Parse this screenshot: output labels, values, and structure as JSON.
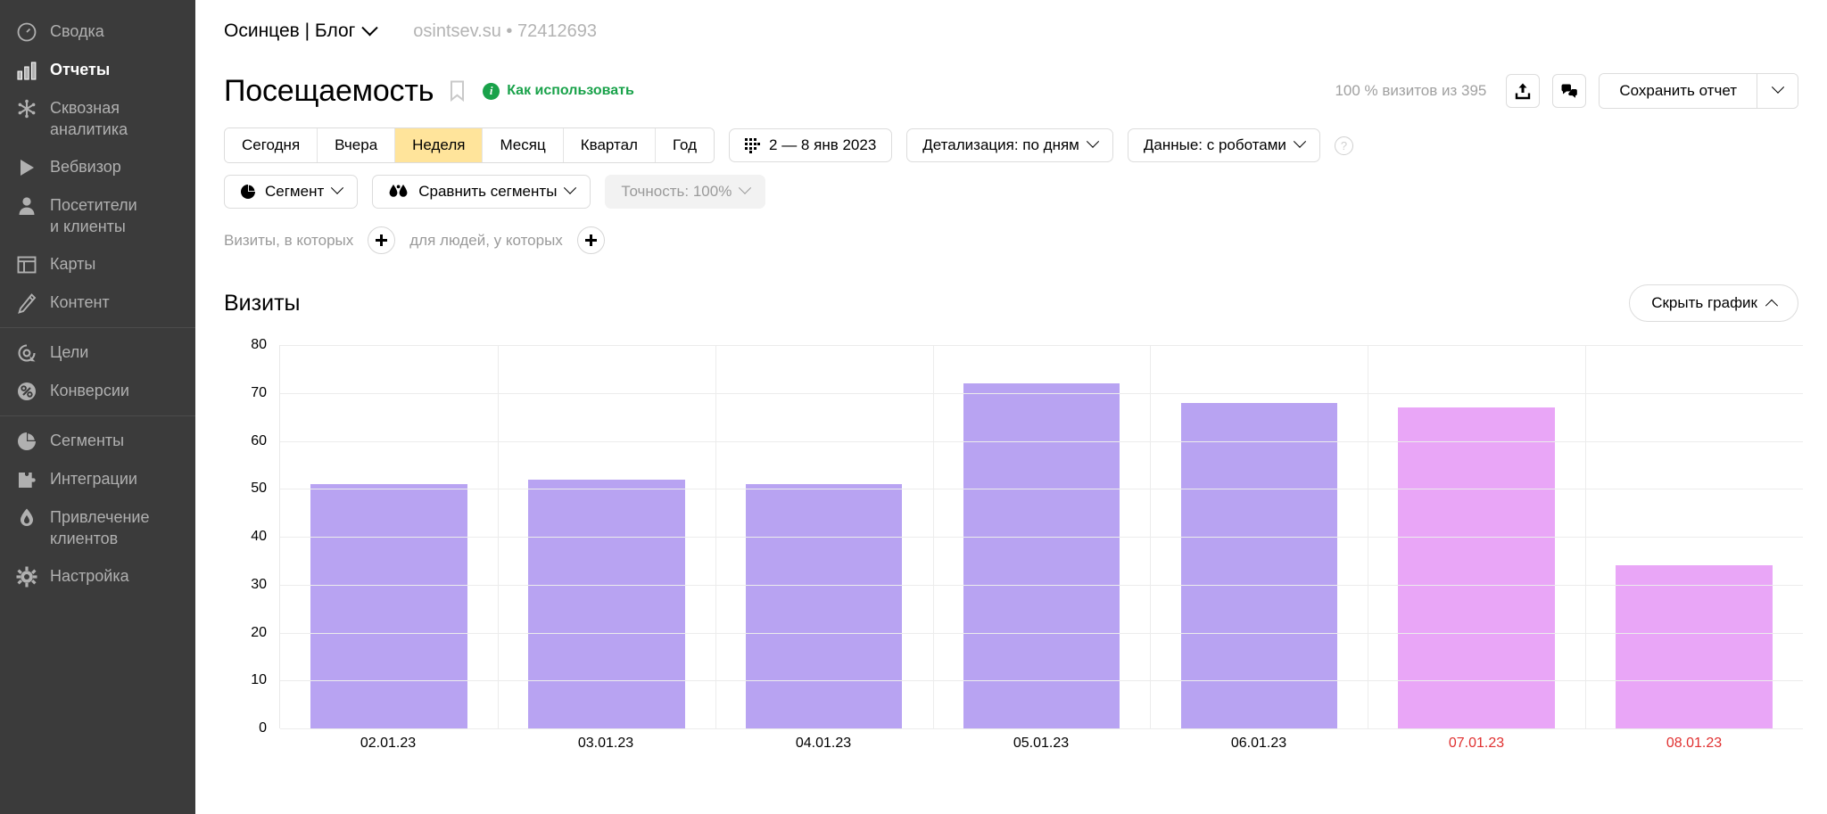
{
  "sidebar": {
    "groups": [
      {
        "items": [
          {
            "label": "Сводка",
            "icon": "gauge-icon",
            "active": false
          },
          {
            "label": "Отчеты",
            "icon": "bar-chart-icon",
            "active": true
          },
          {
            "label": "Сквозная\nаналитика",
            "icon": "snowflake-icon",
            "active": false
          },
          {
            "label": "Вебвизор",
            "icon": "play-icon",
            "active": false
          },
          {
            "label": "Посетители\nи клиенты",
            "icon": "user-icon",
            "active": false
          },
          {
            "label": "Карты",
            "icon": "layout-icon",
            "active": false
          },
          {
            "label": "Контент",
            "icon": "pencil-icon",
            "active": false
          }
        ]
      },
      {
        "items": [
          {
            "label": "Цели",
            "icon": "target-icon",
            "active": false
          },
          {
            "label": "Конверсии",
            "icon": "percent-icon",
            "active": false
          }
        ]
      },
      {
        "items": [
          {
            "label": "Сегменты",
            "icon": "pie-icon",
            "active": false
          },
          {
            "label": "Интеграции",
            "icon": "puzzle-icon",
            "active": false
          },
          {
            "label": "Привлечение\nклиентов",
            "icon": "flame-icon",
            "active": false
          },
          {
            "label": "Настройка",
            "icon": "gear-icon",
            "active": false
          }
        ]
      }
    ]
  },
  "topbar": {
    "site_name": "Осинцев | Блог",
    "site_meta": "osintsev.su • 72412693"
  },
  "title_row": {
    "page_title": "Посещаемость",
    "howto_label": "Как использовать",
    "info_glyph": "i",
    "visits_count": "100 % визитов из 395",
    "share_icon": "export-icon",
    "feedback_icon": "feedback-icon",
    "save_label": "Сохранить отчет"
  },
  "filters": {
    "period_tabs": [
      {
        "label": "Сегодня",
        "active": false
      },
      {
        "label": "Вчера",
        "active": false
      },
      {
        "label": "Неделя",
        "active": true
      },
      {
        "label": "Месяц",
        "active": false
      },
      {
        "label": "Квартал",
        "active": false
      },
      {
        "label": "Год",
        "active": false
      }
    ],
    "date_range": "2 — 8 янв 2023",
    "detail_level": "Детализация: по дням",
    "data_source": "Данные: с роботами",
    "help_glyph": "?",
    "segment_label": "Сегмент",
    "compare_label": "Сравнить сегменты",
    "accuracy_label": "Точность: 100%"
  },
  "conditions": {
    "visits_text": "Визиты, в которых",
    "people_text": "для людей, у которых"
  },
  "chart_header": {
    "title": "Визиты",
    "hide_label": "Скрыть график"
  },
  "colors": {
    "weekday_bar": "#b8a3f2",
    "weekend_bar": "#e9a6f7",
    "active_tab": "#ffe49b",
    "accent_green": "#19a24a",
    "weekend_text": "#e03131",
    "sidebar_bg": "#3b3b3b"
  },
  "chart_data": {
    "type": "bar",
    "title": "Визиты",
    "xlabel": "",
    "ylabel": "",
    "ylim": [
      0,
      80
    ],
    "yticks": [
      80,
      70,
      60,
      50,
      40,
      30,
      20,
      10,
      0
    ],
    "grid": true,
    "legend": "none",
    "categories": [
      "02.01.23",
      "03.01.23",
      "04.01.23",
      "05.01.23",
      "06.01.23",
      "07.01.23",
      "08.01.23"
    ],
    "values": [
      51,
      52,
      51,
      72,
      68,
      67,
      34
    ],
    "weekend_flags": [
      false,
      false,
      false,
      false,
      false,
      true,
      true
    ]
  }
}
